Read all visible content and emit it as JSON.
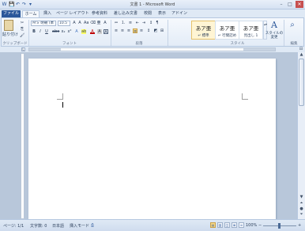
{
  "window": {
    "title": "文書 1 - Microsoft Word",
    "qat": [
      "W",
      "💾",
      "↶",
      "↷",
      "▾"
    ],
    "controls": [
      "–",
      "□",
      "✕"
    ]
  },
  "tabs": [
    "ファイル",
    "ホーム",
    "挿入",
    "ページ レイアウト",
    "参考資料",
    "差し込み文書",
    "校閲",
    "表示",
    "アドイン"
  ],
  "ribbon": {
    "clipboard": {
      "paste": "貼り付け",
      "label": "クリップボード"
    },
    "font": {
      "name": "ＭＳ 明朝 (本",
      "size": "10.5",
      "label": "フォント",
      "buttons": [
        "B",
        "I",
        "U",
        "abe",
        "x₂",
        "x²",
        "A",
        "Aa",
        "A"
      ]
    },
    "paragraph": {
      "label": "段落"
    },
    "styles": {
      "items": [
        {
          "sample": "あア亜",
          "name": "↵ 標準"
        },
        {
          "sample": "あア亜",
          "name": "↵ 行間詰め"
        },
        {
          "sample": "あア亜",
          "name": "見出し 1"
        }
      ],
      "change": "スタイルの 変更",
      "label": "スタイル"
    },
    "editing": {
      "label": "編集"
    }
  },
  "status": {
    "page": "ページ: 1/1",
    "words": "文字数: 0",
    "language": "日本語",
    "mode": "挿入モード",
    "zoom": "100%",
    "zoom_minus": "−",
    "zoom_plus": "+"
  },
  "colors": {
    "accent": "#2b579a",
    "ribbon": "#dfe9f5",
    "page": "#ffffff"
  }
}
